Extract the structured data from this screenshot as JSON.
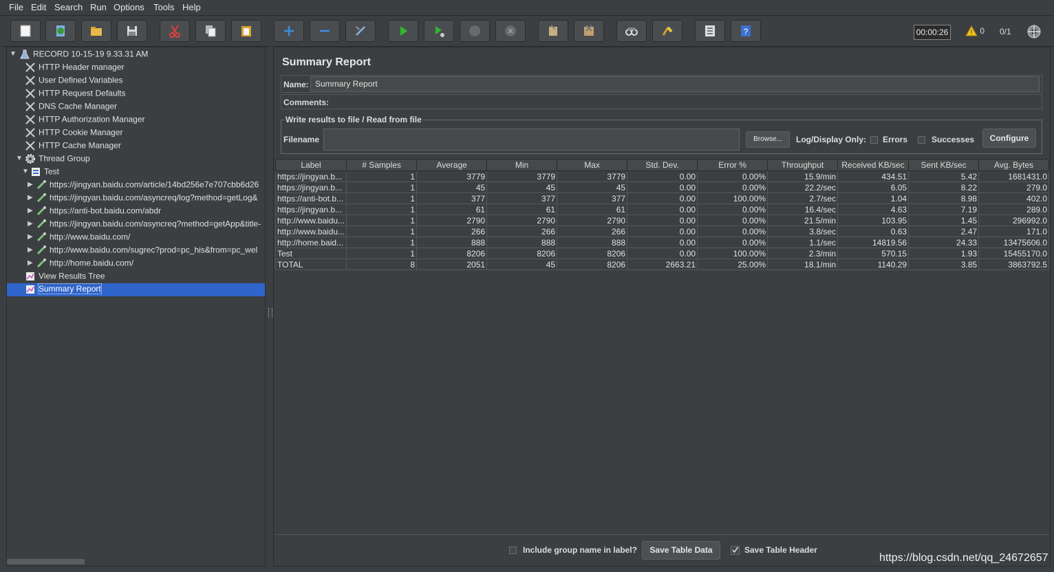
{
  "menu": [
    "File",
    "Edit",
    "Search",
    "Run",
    "Options",
    "Tools",
    "Help"
  ],
  "toolbar": {
    "icons": [
      "new-icon",
      "templates-icon",
      "open-icon",
      "save-icon",
      "cut-icon",
      "copy-icon",
      "paste-icon",
      "expand-icon",
      "collapse-icon",
      "toggle-icon",
      "start-icon",
      "start-no-pause-icon",
      "stop-icon",
      "shutdown-icon",
      "clear-icon",
      "clear-all-icon",
      "search-icon",
      "reset-search-icon",
      "function-helper-icon",
      "help-icon"
    ],
    "timer": "00:00:26",
    "warnings": "0",
    "threads": "0/1"
  },
  "tree": {
    "root": "RECORD 10-15-19 9.33.31 AM",
    "config_elements": [
      "HTTP Header manager",
      "User Defined Variables",
      "HTTP Request Defaults",
      "DNS Cache Manager",
      "HTTP Authorization Manager",
      "HTTP Cookie Manager",
      "HTTP Cache Manager"
    ],
    "thread_group": "Thread Group",
    "controller": "Test",
    "samplers": [
      "https://jingyan.baidu.com/article/14bd256e7e707cbb6d26",
      "https://jingyan.baidu.com/asyncreq/log?method=getLog&",
      "https://anti-bot.baidu.com/abdr",
      "https://jingyan.baidu.com/asyncreq?method=getApp&title-",
      "http://www.baidu.com/",
      "http://www.baidu.com/sugrec?prod=pc_his&from=pc_wel",
      "http://home.baidu.com/"
    ],
    "listeners": [
      "View Results Tree",
      "Summary Report"
    ],
    "selected": "Summary Report"
  },
  "panel": {
    "title": "Summary Report",
    "name_label": "Name:",
    "name_value": "Summary Report",
    "comments_label": "Comments:",
    "file_legend": "Write results to file / Read from file",
    "filename_label": "Filename",
    "browse_label": "Browse...",
    "log_display_label": "Log/Display Only:",
    "errors_label": "Errors",
    "successes_label": "Successes",
    "configure_label": "Configure"
  },
  "table": {
    "columns": [
      "Label",
      "# Samples",
      "Average",
      "Min",
      "Max",
      "Std. Dev.",
      "Error %",
      "Throughput",
      "Received KB/sec",
      "Sent KB/sec",
      "Avg. Bytes"
    ],
    "rows": [
      [
        "https://jingyan.b...",
        "1",
        "3779",
        "3779",
        "3779",
        "0.00",
        "0.00%",
        "15.9/min",
        "434.51",
        "5.42",
        "1681431.0"
      ],
      [
        "https://jingyan.b...",
        "1",
        "45",
        "45",
        "45",
        "0.00",
        "0.00%",
        "22.2/sec",
        "6.05",
        "8.22",
        "279.0"
      ],
      [
        "https://anti-bot.b...",
        "1",
        "377",
        "377",
        "377",
        "0.00",
        "100.00%",
        "2.7/sec",
        "1.04",
        "8.98",
        "402.0"
      ],
      [
        "https://jingyan.b...",
        "1",
        "61",
        "61",
        "61",
        "0.00",
        "0.00%",
        "16.4/sec",
        "4.63",
        "7.19",
        "289.0"
      ],
      [
        "http://www.baidu...",
        "1",
        "2790",
        "2790",
        "2790",
        "0.00",
        "0.00%",
        "21.5/min",
        "103.95",
        "1.45",
        "296992.0"
      ],
      [
        "http://www.baidu...",
        "1",
        "266",
        "266",
        "266",
        "0.00",
        "0.00%",
        "3.8/sec",
        "0.63",
        "2.47",
        "171.0"
      ],
      [
        "http://home.baid...",
        "1",
        "888",
        "888",
        "888",
        "0.00",
        "0.00%",
        "1.1/sec",
        "14819.56",
        "24.33",
        "13475606.0"
      ],
      [
        "Test",
        "1",
        "8206",
        "8206",
        "8206",
        "0.00",
        "100.00%",
        "2.3/min",
        "570.15",
        "1.93",
        "15455170.0"
      ],
      [
        "TOTAL",
        "8",
        "2051",
        "45",
        "8206",
        "2663.21",
        "25.00%",
        "18.1/min",
        "1140.29",
        "3.85",
        "3863792.5"
      ]
    ]
  },
  "bottom": {
    "include_group_label": "Include group name in label?",
    "save_table_data": "Save Table Data",
    "save_table_header": "Save Table Header"
  },
  "watermark": "https://blog.csdn.net/qq_24672657"
}
